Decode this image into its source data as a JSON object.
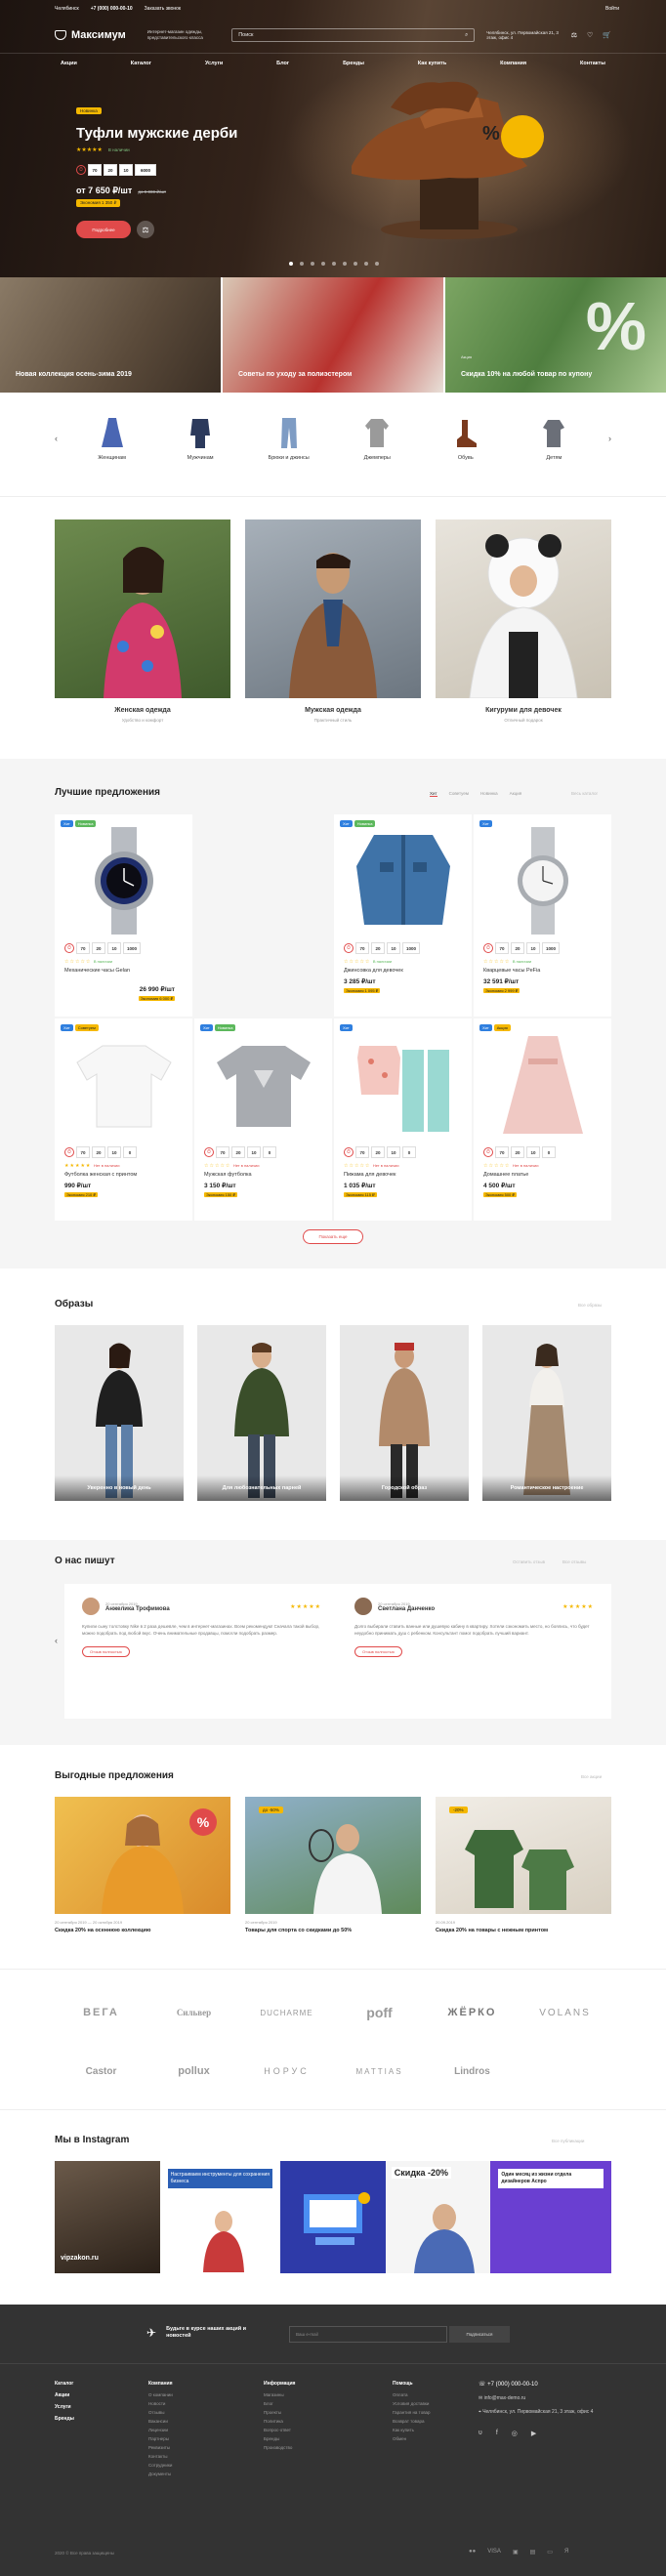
{
  "header": {
    "city": "Челябинск",
    "phone": "+7 (000) 000-00-10",
    "callback": "Заказать звонок",
    "login": "Войти",
    "logo": "Максимум",
    "tagline": "Интернет-магазин одежды, представительского класса",
    "search_placeholder": "Поиск",
    "address": "Челябинск, ул. Первомайская 21, 3 этаж, офис 4",
    "nav": [
      "Акции",
      "Каталог",
      "Услуги",
      "Блог",
      "Бренды",
      "Как купить",
      "Компания",
      "Контакты"
    ]
  },
  "hero": {
    "badge": "Новинка",
    "title": "Туфли мужские дерби",
    "stars": "★★★★★",
    "stock": "В наличии",
    "timer": [
      "70",
      "20",
      "10",
      "6000"
    ],
    "price": "от 7 650 ₽/шт",
    "old_price": "до 9 000 ₽/шт",
    "discount": "Экономия 1 350 ₽",
    "button": "Подробнее",
    "percent_sign": "%"
  },
  "tiles": [
    {
      "title": "Новая коллекция осень-зима 2019",
      "sub": ""
    },
    {
      "title": "Советы по уходу за полиэстером",
      "sub": ""
    },
    {
      "title": "Скидка 10% на любой товар по купону",
      "sub": "Акция"
    }
  ],
  "categories": [
    "Женщинам",
    "Мужчинам",
    "Брюки и джинсы",
    "Джемперы",
    "Обувь",
    "Детям"
  ],
  "collections": [
    {
      "name": "Женская одежда",
      "sub": "Удобство и комфорт"
    },
    {
      "name": "Мужская одежда",
      "sub": "Практичный стиль"
    },
    {
      "name": "Кигуруми для девочек",
      "sub": "Отличный подарок"
    }
  ],
  "best": {
    "title": "Лучшие предложения",
    "tabs": [
      "Хит",
      "Советуем",
      "Новинка",
      "Акция"
    ],
    "all_link": "Весь каталог",
    "more_button": "Показать еще",
    "products": [
      {
        "name": "Механические часы Gelan",
        "price": "26 990 ₽/шт",
        "old": "32 990 ₽",
        "save": "Экономия 6 000 ₽",
        "timer": [
          "70",
          "20",
          "10",
          "1000"
        ],
        "stock": "В наличии",
        "badges": [
          "Хит",
          "Новинка"
        ]
      },
      {
        "name": "Джинсовка для девочек",
        "price": "3 285 ₽/шт",
        "old": "4 380 ₽",
        "save": "Экономия 1 095 ₽",
        "timer": [
          "70",
          "20",
          "10",
          "1000"
        ],
        "stock": "В наличии",
        "badges": [
          "Хит",
          "Новинка"
        ]
      },
      {
        "name": "Кварцевые часы PeFia",
        "price": "32 591 ₽/шт",
        "old": "35 590 ₽",
        "save": "Экономия 2 999 ₽",
        "timer": [
          "70",
          "20",
          "10",
          "1000"
        ],
        "stock": "В наличии",
        "badges": [
          "Хит"
        ]
      },
      {
        "name": "Футболка женская с принтом",
        "price": "990 ₽/шт",
        "old": "1 200 ₽",
        "save": "Экономия 210 ₽",
        "timer": [
          "70",
          "20",
          "10",
          "0"
        ],
        "stock": "Нет в наличии",
        "badges": [
          "Хит",
          "Советуем"
        ]
      },
      {
        "name": "Мужская футболка",
        "price": "3 150 ₽/шт",
        "old": "3 300 ₽",
        "save": "Экономия 150 ₽",
        "timer": [
          "70",
          "20",
          "10",
          "0"
        ],
        "stock": "Нет в наличии",
        "badges": [
          "Хит",
          "Новинка"
        ]
      },
      {
        "name": "Пижама для девочек",
        "price": "1 035 ₽/шт",
        "old": "1 150 ₽",
        "save": "Экономия 115 ₽",
        "timer": [
          "70",
          "20",
          "10",
          "0"
        ],
        "stock": "Нет в наличии",
        "badges": [
          "Хит"
        ]
      },
      {
        "name": "Домашнее платье",
        "price": "4 500 ₽/шт",
        "old": "5 000 ₽",
        "save": "Экономия 500 ₽",
        "timer": [
          "70",
          "20",
          "10",
          "0"
        ],
        "stock": "Нет в наличии",
        "badges": [
          "Хит",
          "Акция"
        ]
      }
    ]
  },
  "looks": {
    "title": "Образы",
    "all_link": "Все образы",
    "items": [
      "Уверенно в новый день",
      "Для любознательных парней",
      "Городской образ",
      "Романтическое настроение"
    ]
  },
  "reviews": {
    "title": "О нас пишут",
    "add_link": "Оставить отзыв",
    "all_link": "Все отзывы",
    "items": [
      {
        "name": "Анжелика Трофимова",
        "date": "20 сентября 2019",
        "stars": "★★★★★",
        "text": "Купили сыну толстовку Nike в 2 раза дешевле, чем в интернет-магазинах. Всем рекомендую! Сначала такой выбор, можно подобрать под любой вкус. Очень внимательные продавцы, помогли подобрать размер.",
        "more": "Отзыв полностью"
      },
      {
        "name": "Светлана Данченко",
        "date": "20 сентября 2019",
        "stars": "★★★★★",
        "text": "Долго выбирали ставить ванные или душевую кабину в квартиру. Хотели сэкономить место, но боялись, что будет неудобно принимать душ с ребенком. Консультант помог подобрать лучший вариант.",
        "more": "Отзыв полностью"
      }
    ]
  },
  "deals": {
    "title": "Выгодные предложения",
    "all_link": "Все акции",
    "items": [
      {
        "name": "Скидка 20% на осеннюю коллекцию",
        "date": "20 сентября 2019 — 20 октября 2019",
        "tag": "Акция"
      },
      {
        "name": "Товары для спорта со скидками до 50%",
        "date": "20 сентября 2019",
        "tag": "до -50%"
      },
      {
        "name": "Скидка 20% на товары с нежным принтом",
        "date": "20.09.2019",
        "tag": "-20%"
      }
    ]
  },
  "brands": [
    "ВЕГА",
    "Сильвер",
    "DUCHARME",
    "poff",
    "ЖЁРКО",
    "VOLANS",
    "Castor",
    "pollux",
    "НОРУС",
    "MATTIAS",
    "Lindros"
  ],
  "instagram": {
    "title": "Мы в Instagram",
    "link": "Все публикации",
    "posts": [
      "vipzakon.ru",
      "Настраиваем инструменты для сохранения бизнеса",
      "",
      "Скидка -20%",
      "Один месяц из жизни отдела дизайнеров Аспро"
    ]
  },
  "footer": {
    "subscribe_text": "Будьте в курсе наших акций и новостей",
    "email_placeholder": "Ваш e-mail",
    "subscribe_button": "Подписаться",
    "menu": [
      "Каталог",
      "Акции",
      "Услуги",
      "Бренды"
    ],
    "cols": [
      {
        "h": "Компания",
        "items": [
          "О компании",
          "Новости",
          "Отзывы",
          "Вакансии",
          "Лицензии",
          "Партнеры",
          "Реквизиты",
          "Контакты",
          "Сотрудники",
          "Документы"
        ]
      },
      {
        "h": "Информация",
        "items": [
          "Магазины",
          "Блог",
          "Проекты",
          "Политика",
          "Вопрос-ответ",
          "Бренды",
          "Производство"
        ]
      },
      {
        "h": "Помощь",
        "items": [
          "Оплата",
          "Условия доставки",
          "Гарантия на товар",
          "Возврат товара",
          "Как купить",
          "Обмен"
        ]
      }
    ],
    "phone": "+7 (000) 000-00-10",
    "email": "info@max-demo.ru",
    "address": "Челябинск, ул. Первомайская 21, 3 этаж, офис 4",
    "copyright": "2020 © Все права защищены"
  }
}
